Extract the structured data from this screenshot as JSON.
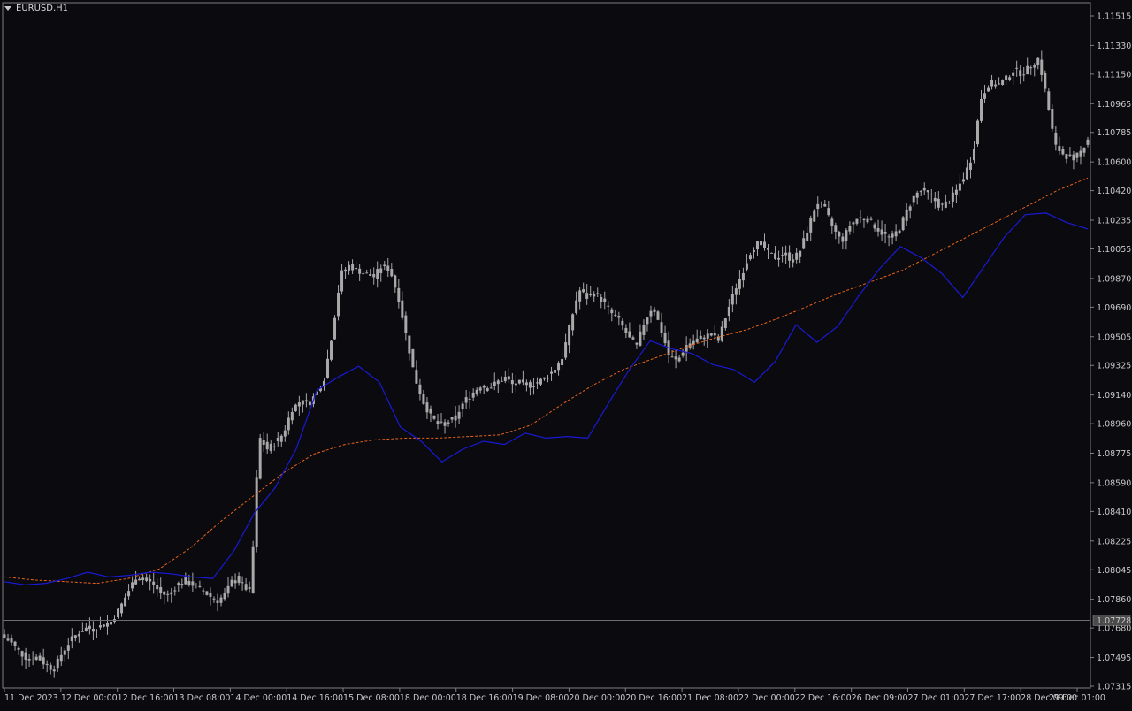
{
  "window": {
    "symbol_timeframe": "EURUSD,H1"
  },
  "colors": {
    "background": "#0a0a0f",
    "candle": "#a9a9a9",
    "fast_ma": "#1a1ad6",
    "slow_ma": "#e8641a",
    "frame": "#808080",
    "current_price_tag_bg": "#4b4b4b"
  },
  "icons": {
    "symbol_menu": "chevron-down-icon"
  },
  "chart_data": {
    "type": "candlestick",
    "symbol": "EURUSD",
    "timeframe": "H1",
    "current_price": "1.07728",
    "y_axis": {
      "range": [
        1.07315,
        1.1156
      ],
      "ticks": [
        "1.11515",
        "1.11330",
        "1.11150",
        "1.10965",
        "1.10785",
        "1.10600",
        "1.10420",
        "1.10235",
        "1.10055",
        "1.09870",
        "1.09690",
        "1.09505",
        "1.09325",
        "1.09140",
        "1.08960",
        "1.08775",
        "1.08590",
        "1.08410",
        "1.08225",
        "1.08045",
        "1.07860",
        "1.07680",
        "1.07495",
        "1.07315"
      ]
    },
    "x_axis": {
      "labels": [
        "11 Dec 2023",
        "12 Dec 00:00",
        "12 Dec 16:00",
        "13 Dec 08:00",
        "14 Dec 00:00",
        "14 Dec 16:00",
        "15 Dec 08:00",
        "18 Dec 00:00",
        "18 Dec 16:00",
        "19 Dec 08:00",
        "20 Dec 00:00",
        "20 Dec 16:00",
        "21 Dec 08:00",
        "22 Dec 00:00",
        "22 Dec 16:00",
        "26 Dec 09:00",
        "27 Dec 01:00",
        "27 Dec 17:00",
        "28 Dec 09:00",
        "29 Dec 01:00"
      ]
    },
    "close_path": [
      1.0762,
      1.0758,
      1.0752,
      1.0748,
      1.075,
      1.0745,
      1.0742,
      1.0752,
      1.076,
      1.0765,
      1.0768,
      1.0767,
      1.077,
      1.0772,
      1.078,
      1.079,
      1.08,
      1.0798,
      1.0796,
      1.079,
      1.0788,
      1.0795,
      1.0798,
      1.0795,
      1.0792,
      1.0788,
      1.0785,
      1.079,
      1.08,
      1.0795,
      1.079,
      1.0888,
      1.088,
      1.0884,
      1.089,
      1.0905,
      1.091,
      1.0908,
      1.0915,
      1.0925,
      1.0955,
      1.099,
      1.0995,
      1.0992,
      1.099,
      1.0988,
      1.0995,
      1.0992,
      1.0975,
      1.095,
      1.0925,
      1.091,
      1.09,
      1.0895,
      1.0897,
      1.09,
      1.091,
      1.0915,
      1.092,
      1.0918,
      1.0922,
      1.0925,
      1.092,
      1.0922,
      1.092,
      1.0922,
      1.0925,
      1.093,
      1.0938,
      1.096,
      1.098,
      1.0975,
      1.0978,
      1.0972,
      1.0965,
      1.096,
      1.095,
      1.0945,
      1.096,
      1.097,
      1.0955,
      1.0938,
      1.0935,
      1.0945,
      1.0948,
      1.095,
      1.0952,
      1.0948,
      1.0965,
      1.098,
      1.0992,
      1.1005,
      1.101,
      1.1003,
      1.1,
      1.1003,
      1.0998,
      1.1005,
      1.102,
      1.1035,
      1.103,
      1.1018,
      1.101,
      1.102,
      1.1025,
      1.1025,
      1.102,
      1.1015,
      1.1012,
      1.1018,
      1.103,
      1.104,
      1.1042,
      1.1038,
      1.1032,
      1.1035,
      1.1042,
      1.1052,
      1.1065,
      1.11,
      1.111,
      1.1108,
      1.1112,
      1.1118,
      1.1115,
      1.112,
      1.1125,
      1.11,
      1.107,
      1.1065,
      1.1062,
      1.1065,
      1.1075
    ],
    "fast_ma_path": [
      1.0797,
      1.0795,
      1.0796,
      1.0799,
      1.0803,
      1.08,
      1.0801,
      1.0803,
      1.0802,
      1.08,
      1.0799,
      1.0816,
      1.084,
      1.0856,
      1.088,
      1.0917,
      1.0925,
      1.0932,
      1.0922,
      1.0894,
      1.0885,
      1.0872,
      1.088,
      1.0885,
      1.0883,
      1.089,
      1.0887,
      1.0888,
      1.0887,
      1.0909,
      1.093,
      1.0948,
      1.0943,
      1.094,
      1.0933,
      1.093,
      1.0922,
      1.0935,
      1.0958,
      1.0947,
      1.0957,
      1.0976,
      1.0993,
      1.1007,
      1.1,
      1.099,
      1.0975,
      1.0994,
      1.1013,
      1.1027,
      1.1028,
      1.1022,
      1.1018
    ],
    "slow_ma_path": [
      1.08,
      1.0798,
      1.0797,
      1.0796,
      1.0799,
      1.0805,
      1.0818,
      1.0835,
      1.085,
      1.0865,
      1.0877,
      1.0883,
      1.0886,
      1.0887,
      1.0887,
      1.0888,
      1.0889,
      1.0895,
      1.0908,
      1.092,
      1.093,
      1.0937,
      1.0944,
      1.095,
      1.0955,
      1.0962,
      1.097,
      1.0978,
      1.0985,
      1.0992,
      1.1002,
      1.1012,
      1.1022,
      1.1032,
      1.1042,
      1.105
    ]
  }
}
